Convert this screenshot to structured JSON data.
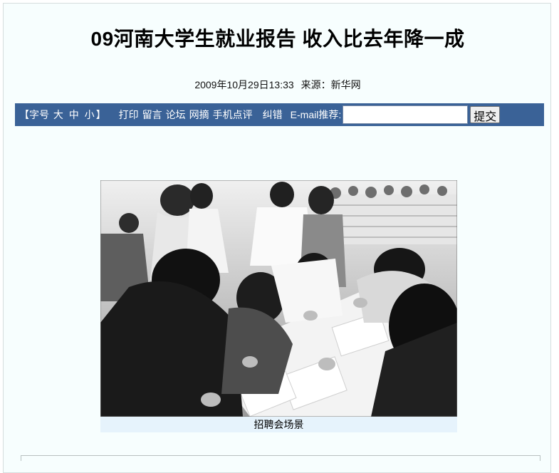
{
  "article": {
    "title": "09河南大学生就业报告 收入比去年降一成",
    "datetime": "2009年10月29日13:33",
    "source": "来源：新华网"
  },
  "toolbar": {
    "font_size_open": "【字号",
    "font_size_large": "大",
    "font_size_medium": "中",
    "font_size_small": "小",
    "font_size_close": "】",
    "print": "打印",
    "comment": "留言",
    "forum": "论坛",
    "excerpt": "网摘",
    "mobile_review": "手机点评",
    "correction": "纠错",
    "email_label": "E-mail推荐:",
    "email_value": "",
    "submit": "提交"
  },
  "photo": {
    "caption": "招聘会场景",
    "icon": "photo-image",
    "description_colors": [
      "#1c1c1c",
      "#5a5a5a",
      "#cfcfcf",
      "#f2f2f2"
    ]
  },
  "colors": {
    "toolbar_bg": "#3a6297",
    "page_bg": "#f7fefe",
    "caption_bg": "#e6f3fc"
  }
}
